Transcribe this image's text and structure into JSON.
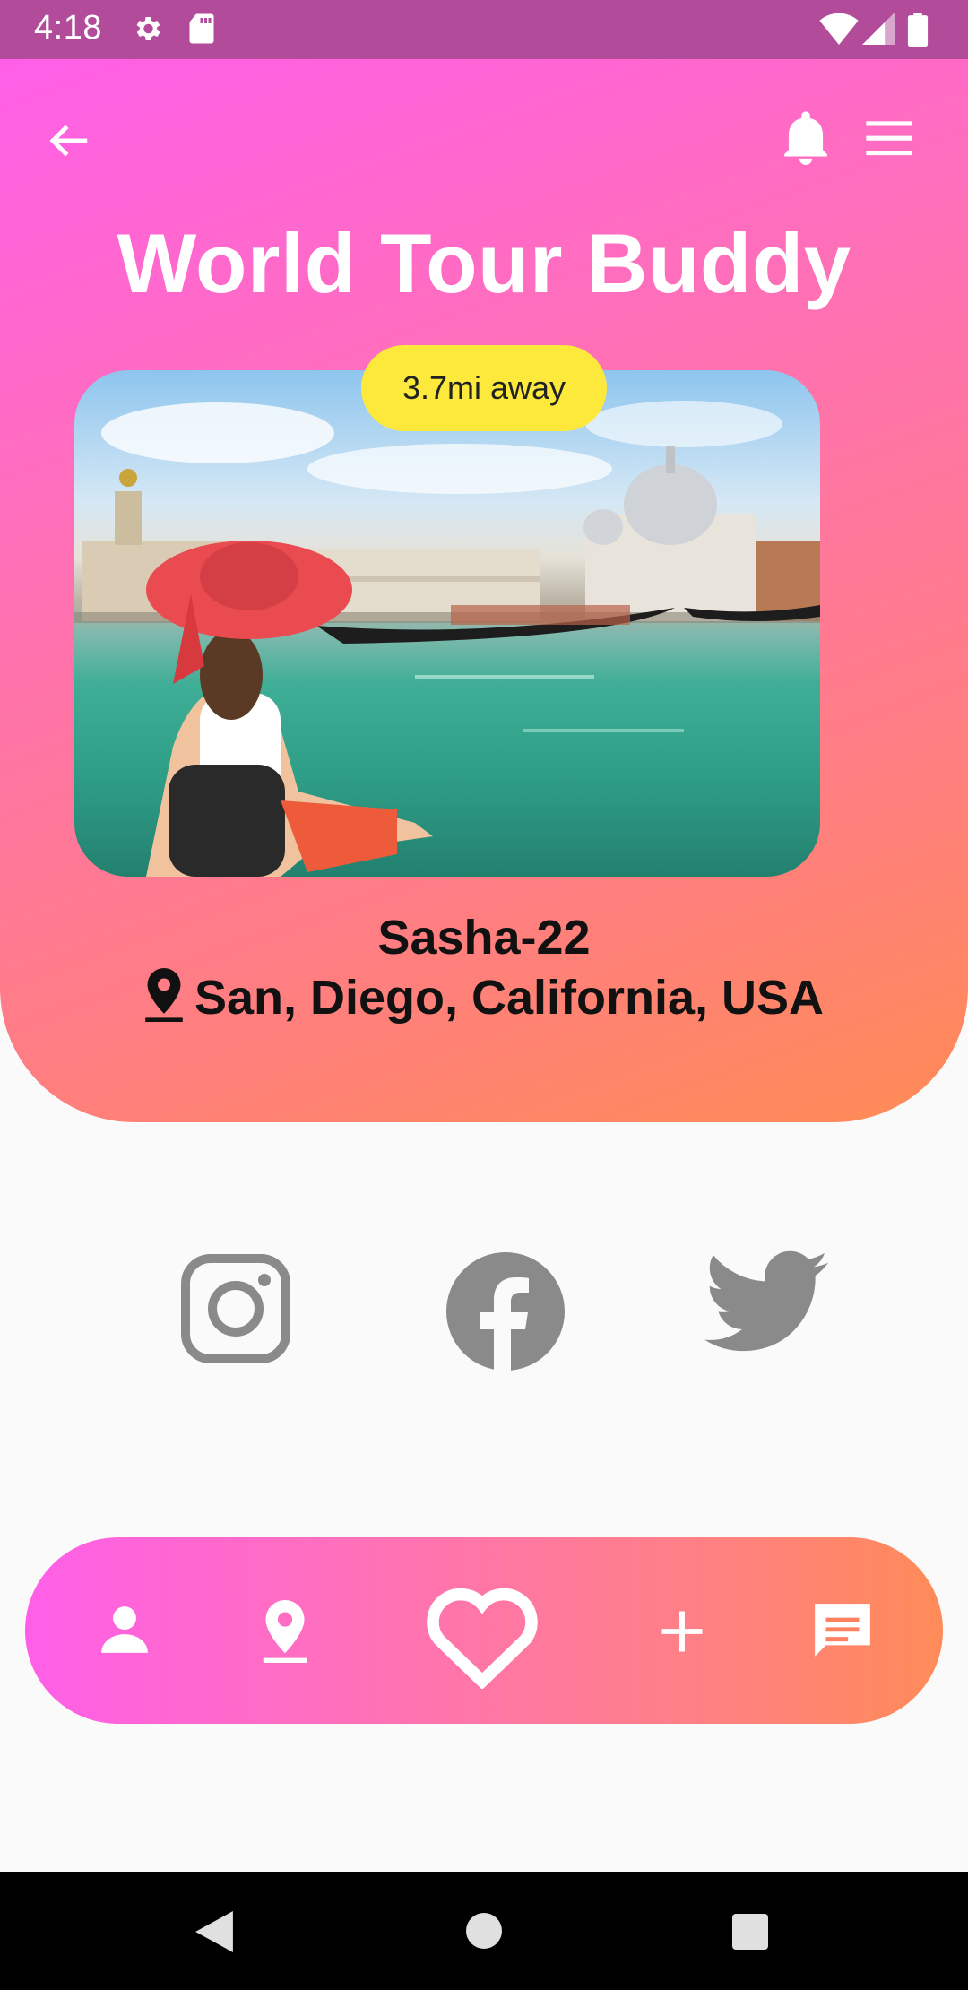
{
  "status_bar": {
    "time": "4:18",
    "icons": [
      "settings-icon",
      "sd-card-icon",
      "wifi-icon",
      "signal-icon",
      "battery-icon"
    ]
  },
  "header": {
    "title": "World Tour Buddy",
    "icons": [
      "back-arrow-icon",
      "bell-icon",
      "menu-icon"
    ]
  },
  "profile": {
    "distance": "3.7mi away",
    "name": "Sasha-22",
    "location": "San, Diego, California, USA"
  },
  "social": [
    "instagram-icon",
    "facebook-icon",
    "twitter-icon"
  ],
  "bottom_nav": [
    "person-icon",
    "location-pin-icon",
    "heart-icon",
    "plus-icon",
    "chat-icon"
  ],
  "system_nav": [
    "back-triangle-icon",
    "home-circle-icon",
    "recents-square-icon"
  ],
  "colors": {
    "gradient_start": "#ff5fe8",
    "gradient_end": "#ff8b55",
    "badge": "#fde93b",
    "social_icon": "#8a8a8a",
    "status_bar": "#b24c9a"
  }
}
